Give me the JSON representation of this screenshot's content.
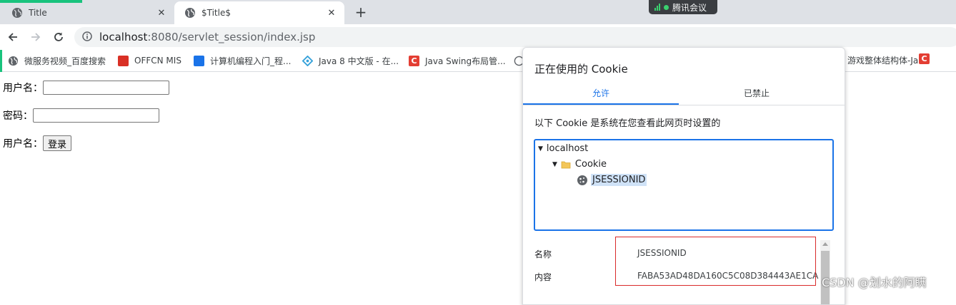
{
  "tabs": [
    {
      "title": "Title",
      "active": false
    },
    {
      "title": "$Title$",
      "active": true
    }
  ],
  "new_tab": "+",
  "tab_close": "✕",
  "meeting_widget": {
    "label": "腾讯会议",
    "accent": "#3ad06f"
  },
  "address_bar": {
    "host": "localhost",
    "rest": ":8080/servlet_session/index.jsp"
  },
  "bookmarks": [
    {
      "label": "微服务视频_百度搜索",
      "icon": "globe-icon",
      "color": "#5f6368"
    },
    {
      "label": "OFFCN MIS",
      "icon": "offcn-icon",
      "color": "#d93025"
    },
    {
      "label": "计算机编程入门_程...",
      "icon": "page-icon",
      "color": "#1a73e8"
    },
    {
      "label": "Java 8 中文版 - 在...",
      "icon": "runoob-icon",
      "color": "#37a2da"
    },
    {
      "label": "Java Swing布局管...",
      "icon": "csdn-icon",
      "color": "#e33e33"
    }
  ],
  "bookmarks_right": [
    {
      "label": "游戏整体结构体-Ja...",
      "icon": "csdn-icon",
      "color": "#e33e33"
    }
  ],
  "page": {
    "username_label": "用户名：",
    "password_label": "密码：",
    "login_row_label": "用户名：",
    "login_button": "登录"
  },
  "cookie_dialog": {
    "title": "正在使用的 Cookie",
    "tab_allowed": "允许",
    "tab_blocked": "已禁止",
    "description": "以下 Cookie 是系统在您查看此网页时设置的",
    "tree": {
      "site": "localhost",
      "folder": "Cookie",
      "cookie": "JSESSIONID"
    },
    "fields": [
      {
        "label": "名称",
        "value": "JSESSIONID"
      },
      {
        "label": "内容",
        "value": "FABA53AD48DA160C5C08D384443AE1CA"
      }
    ],
    "accent": "#1a73e8",
    "highlight_border": "#d92b2b"
  },
  "watermark": "CSDN @划水的阿瞒"
}
